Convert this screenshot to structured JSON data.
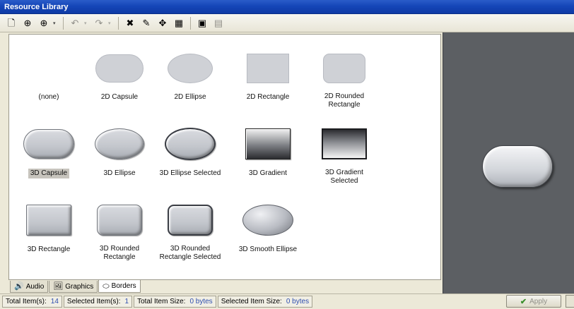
{
  "window": {
    "title": "Resource Library"
  },
  "toolbar": {
    "buttons": [
      {
        "icon": "new-icon",
        "glyph": "🗋"
      },
      {
        "icon": "add-green-icon",
        "glyph": "⊕"
      },
      {
        "icon": "add-dropdown-icon",
        "glyph": "⊕",
        "has_dropdown": true
      },
      {
        "icon": "undo-icon",
        "glyph": "↶",
        "has_dropdown": true,
        "disabled": true
      },
      {
        "icon": "redo-icon",
        "glyph": "↷",
        "has_dropdown": true,
        "disabled": true
      },
      {
        "icon": "delete-icon",
        "glyph": "✖"
      },
      {
        "icon": "edit-icon",
        "glyph": "✎"
      },
      {
        "icon": "move-icon",
        "glyph": "✥"
      },
      {
        "icon": "grid-icon",
        "glyph": "▦"
      },
      {
        "icon": "save-icon",
        "glyph": "▣"
      },
      {
        "icon": "properties-icon",
        "glyph": "▤",
        "disabled": true
      }
    ]
  },
  "gallery": {
    "items": [
      {
        "label": "(none)",
        "shape": "none"
      },
      {
        "label": "2D Capsule",
        "shape": "cap2d"
      },
      {
        "label": "2D Ellipse",
        "shape": "ell2d"
      },
      {
        "label": "2D Rectangle",
        "shape": "rect2d"
      },
      {
        "label": "2D Rounded Rectangle",
        "shape": "rrect2d"
      },
      {
        "label": "3D Capsule",
        "shape": "cap3d",
        "selected": true
      },
      {
        "label": "3D Ellipse",
        "shape": "ell3d"
      },
      {
        "label": "3D Ellipse Selected",
        "shape": "ellsel3d"
      },
      {
        "label": "3D Gradient",
        "shape": "grad3d"
      },
      {
        "label": "3D Gradient Selected",
        "shape": "gradsel3d"
      },
      {
        "label": "3D Rectangle",
        "shape": "rect3d"
      },
      {
        "label": "3D Rounded Rectangle",
        "shape": "rrect3d"
      },
      {
        "label": "3D Rounded Rectangle Selected",
        "shape": "rrectsel3d"
      },
      {
        "label": "3D Smooth Ellipse",
        "shape": "smooth3d"
      }
    ]
  },
  "tabs": [
    {
      "label": "Audio",
      "icon": "audio-icon",
      "glyph": "🔊",
      "active": false
    },
    {
      "label": "Graphics",
      "icon": "graphics-icon",
      "glyph": "🖼",
      "active": false
    },
    {
      "label": "Borders",
      "icon": "borders-icon",
      "glyph": "⬭",
      "active": true
    }
  ],
  "status": {
    "total_items_label": "Total Item(s):",
    "total_items_value": "14",
    "selected_items_label": "Selected Item(s):",
    "selected_items_value": "1",
    "total_size_label": "Total Item Size:",
    "total_size_value": "0 bytes",
    "selected_size_label": "Selected Item Size:",
    "selected_size_value": "0 bytes"
  },
  "apply": {
    "label": "Apply"
  },
  "colors": {
    "title_bar": "#1546b8",
    "preview_bg": "#5c5f63",
    "status_value": "#2f4fb0"
  }
}
